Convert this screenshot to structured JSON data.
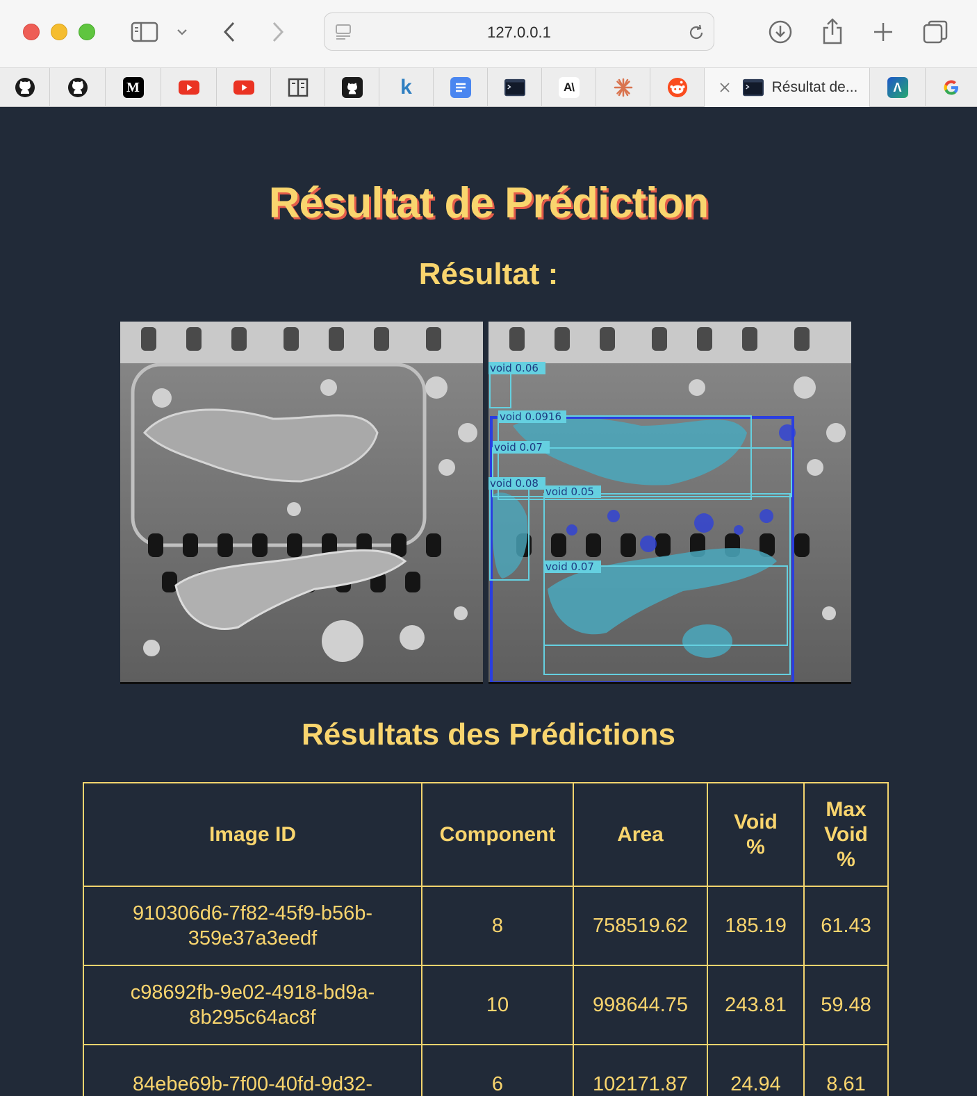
{
  "browser": {
    "url": "127.0.0.1",
    "active_tab_title": "Résultat de...",
    "tabs": [
      {
        "icon": "github-icon"
      },
      {
        "icon": "github-icon"
      },
      {
        "icon": "medium-icon",
        "label": "M"
      },
      {
        "icon": "youtube-icon"
      },
      {
        "icon": "youtube-icon"
      },
      {
        "icon": "reader-icon"
      },
      {
        "icon": "github-icon"
      },
      {
        "icon": "k-icon",
        "label": "k"
      },
      {
        "icon": "docs-icon"
      },
      {
        "icon": "terminal-icon"
      },
      {
        "icon": "anthropic-icon",
        "label": "A\\"
      },
      {
        "icon": "asterisk-icon"
      },
      {
        "icon": "reddit-icon"
      },
      {
        "icon": "active-tab"
      },
      {
        "icon": "arc-icon",
        "label": "Λ"
      },
      {
        "icon": "google-icon",
        "label": "G"
      }
    ]
  },
  "page": {
    "title": "Résultat de Prédiction",
    "result_heading": "Résultat :",
    "table_heading": "Résultats des Prédictions",
    "detections": [
      {
        "label": "void 0.06"
      },
      {
        "label": "void 0.0916"
      },
      {
        "label": "void 0.07"
      },
      {
        "label": "void 0.08"
      },
      {
        "label": "void 0.05"
      },
      {
        "label": "void 0.07"
      }
    ],
    "table": {
      "headers": [
        "Image ID",
        "Component",
        "Area",
        "Void %",
        "Max Void %"
      ],
      "rows": [
        [
          "910306d6-7f82-45f9-b56b-359e37a3eedf",
          "8",
          "758519.62",
          "185.19",
          "61.43"
        ],
        [
          "c98692fb-9e02-4918-bd9a-8b295c64ac8f",
          "10",
          "998644.75",
          "243.81",
          "59.48"
        ],
        [
          "84ebe69b-7f00-40fd-9d32-",
          "6",
          "102171.87",
          "24.94",
          "8.61"
        ]
      ]
    }
  },
  "colors": {
    "background": "#212a38",
    "heading": "#f9d56e",
    "title_shadow": "#e45c4a",
    "table_border": "#f2d46e"
  }
}
